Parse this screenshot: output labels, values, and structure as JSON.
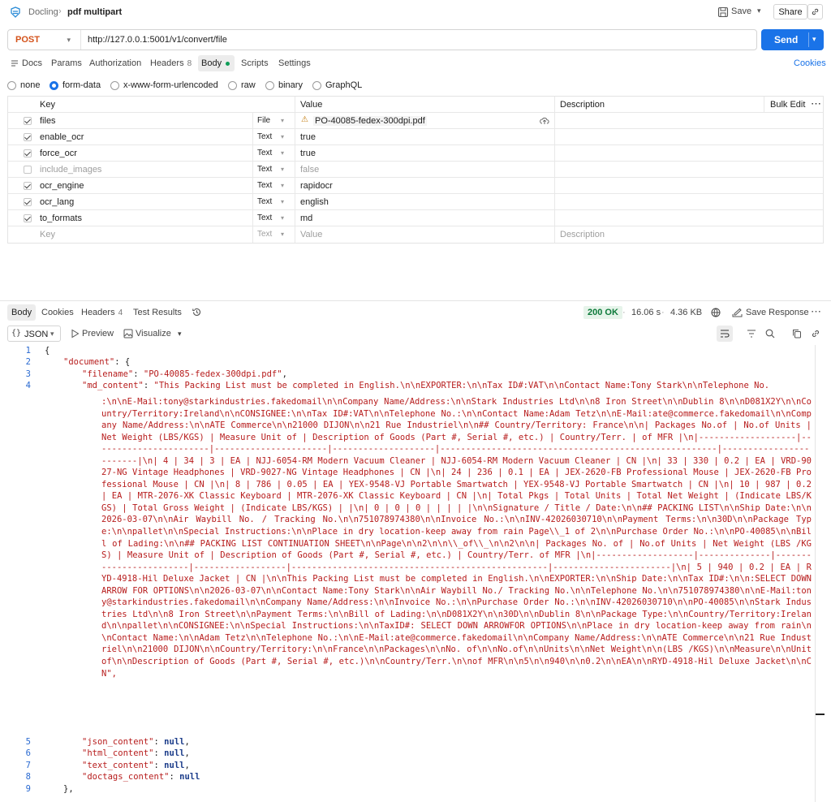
{
  "header": {
    "breadcrumb_root": "Docling",
    "breadcrumb_sep": "›",
    "request_name": "pdf multipart",
    "save_label": "Save",
    "share_label": "Share"
  },
  "request": {
    "method": "POST",
    "url": "http://127.0.0.1:5001/v1/convert/file",
    "send_label": "Send"
  },
  "tabs": {
    "docs": "Docs",
    "params": "Params",
    "authorization": "Authorization",
    "headers": "Headers",
    "headers_count": "8",
    "body": "Body",
    "scripts": "Scripts",
    "settings": "Settings",
    "cookies": "Cookies"
  },
  "body_types": [
    "none",
    "form-data",
    "x-www-form-urlencoded",
    "raw",
    "binary",
    "GraphQL"
  ],
  "selected_body_type": "form-data",
  "params_table": {
    "headers": {
      "key": "Key",
      "value": "Value",
      "description": "Description",
      "bulk_edit": "Bulk Edit"
    },
    "rows": [
      {
        "checked": true,
        "key": "files",
        "type": "File",
        "value": "PO-40085-fedex-300dpi.pdf"
      },
      {
        "checked": true,
        "key": "enable_ocr",
        "type": "Text",
        "value": "true"
      },
      {
        "checked": true,
        "key": "force_ocr",
        "type": "Text",
        "value": "true"
      },
      {
        "checked": false,
        "key": "include_images",
        "type": "Text",
        "value": "false"
      },
      {
        "checked": true,
        "key": "ocr_engine",
        "type": "Text",
        "value": "rapidocr"
      },
      {
        "checked": true,
        "key": "ocr_lang",
        "type": "Text",
        "value": "english"
      },
      {
        "checked": true,
        "key": "to_formats",
        "type": "Text",
        "value": "md"
      }
    ],
    "placeholder_row": {
      "key": "Key",
      "type": "Text",
      "value": "Value",
      "description": "Description"
    }
  },
  "response": {
    "tabs": {
      "body": "Body",
      "cookies": "Cookies",
      "headers": "Headers",
      "headers_count": "4",
      "test_results": "Test Results"
    },
    "status": "200 OK",
    "time": "16.06 s",
    "size": "4.36 KB",
    "save_response": "Save Response",
    "format": "JSON",
    "preview": "Preview",
    "visualize": "Visualize"
  },
  "code": {
    "line1": "{",
    "line2_key": "\"document\"",
    "line2_rest": ": {",
    "line3_key": "\"filename\"",
    "line3_val": "\"PO-40085-fedex-300dpi.pdf\"",
    "line4_key": "\"md_content\"",
    "line4_first": "\"This Packing List must be completed in English.\\n\\nEXPORTER:\\n\\nTax ID#:VAT\\n\\nContact Name:Tony Stark\\n\\nTelephone No.",
    "md_content_rest": ":\\n\\nE-Mail:tony@starkindustries.fakedomail\\n\\nCompany Name/Address:\\n\\nStark Industries Ltd\\n\\n8 Iron Street\\n\\nDublin 8\\n\\nD081X2Y\\n\\nCountry/Territory:Ireland\\n\\nCONSIGNEE:\\n\\nTax ID#:VAT\\n\\nTelephone No.:\\n\\nContact Name:Adam Tetz\\n\\nE-Mail:ate@commerce.fakedomail\\n\\nCompany Name/Address:\\n\\nATE Commerce\\n\\n21000 DIJON\\n\\n21 Rue Industriel\\n\\n## Country/Territory: France\\n\\n| Packages No.of | No.of Units | Net Weight (LBS/KGS) | Measure Unit of | Description of Goods (Part #, Serial #, etc.) | Country/Terr. | of MFR |\\n|-------------------|-----------------------|----------------------|--------------------|------------------------------------------------------|------------------------|\\n| 4 | 34 | 3 | EA | NJJ-6054-RM Modern Vacuum Cleaner | NJJ-6054-RM Modern Vacuum Cleaner | CN |\\n| 33 | 330 | 0.2 | EA | VRD-9027-NG Vintage Headphones | VRD-9027-NG Vintage Headphones | CN |\\n| 24 | 236 | 0.1 | EA | JEX-2620-FB Professional Mouse | JEX-2620-FB Professional Mouse | CN |\\n| 8 | 786 | 0.05 | EA | YEX-9548-VJ Portable Smartwatch | YEX-9548-VJ Portable Smartwatch | CN |\\n| 10 | 987 | 0.2 | EA | MTR-2076-XK Classic Keyboard | MTR-2076-XK Classic Keyboard | CN |\\n| Total Pkgs | Total Units | Total Net Weight | (Indicate LBS/KGS) | Total Gross Weight | (Indicate LBS/KGS) | |\\n| 0 | 0 | 0 | | | | |\\n\\nSignature / Title / Date:\\n\\n## PACKING LIST\\n\\nShip Date:\\n\\n2026-03-07\\n\\nAir Waybill No. / Tracking No.\\n\\n751078974380\\n\\nInvoice No.:\\n\\nINV-42026030710\\n\\nPayment Terms:\\n\\n30D\\n\\nPackage Type:\\n\\npallet\\n\\nSpecial Instructions:\\n\\nPlace in dry location-keep away from rain Page\\\\_1 of 2\\n\\nPurchase Order No.:\\n\\nPO-40085\\n\\nBill of Lading:\\n\\n## PACKING LIST CONTINUATION SHEET\\n\\nPage\\n\\n2\\n\\n\\\\_of\\\\_\\n\\n2\\n\\n| Packages No. of | No.of Units | Net Weight (LBS /KGS) | Measure Unit of | Description of Goods (Part #, Serial #, etc.) | Country/Terr. of MFR |\\n|-------------------|--------------|------------------------|------------------|--------------------------------------------------|-----------------------|\\n| 5 | 940 | 0.2 | EA | RYD-4918-Hil Deluxe Jacket | CN |\\n\\nThis Packing List must be completed in English.\\n\\nEXPORTER:\\n\\nShip Date:\\n\\nTax ID#:\\n\\n:SELECT DOWN ARROW FOR OPTIONS\\n\\n2026-03-07\\n\\nContact Name:Tony Stark\\n\\nAir Waybill No./ Tracking No.\\n\\nTelephone No.\\n\\n751078974380\\n\\nE-Mail:tony@starkindustries.fakedomail\\n\\nCompany Name/Address:\\n\\nInvoice No.:\\n\\nPurchase Order No.:\\n\\nINV-42026030710\\n\\nPO-40085\\n\\nStark Industries Ltd\\n\\n8 Iron Street\\n\\nPayment Terms:\\n\\nBill of Lading:\\n\\nD081X2Y\\n\\n30D\\n\\nDublin 8\\n\\nPackage Type:\\n\\nCountry/Territory:Ireland\\n\\npallet\\n\\nCONSIGNEE:\\n\\nSpecial Instructions:\\n\\nTaxID#: SELECT DOWN ARROWFOR OPTIONS\\n\\nPlace in dry location-keep away from rain\\n\\nContact Name:\\n\\nAdam Tetz\\n\\nTelephone No.:\\n\\nE-Mail:ate@commerce.fakedomail\\n\\nCompany Name/Address:\\n\\nATE Commerce\\n\\n21 Rue Industriel\\n\\n21000 DIJON\\n\\nCountry/Territory:\\n\\nFrance\\n\\nPackages\\n\\nNo. of\\n\\nNo.of\\n\\nUnits\\n\\nNet Weight\\n\\n(LBS /KGS)\\n\\nMeasure\\n\\nUnit of\\n\\nDescription of Goods (Part #, Serial #, etc.)\\n\\nCountry/Terr.\\n\\nof MFR\\n\\n5\\n\\n940\\n\\n0.2\\n\\nEA\\n\\nRYD-4918-Hil Deluxe Jacket\\n\\nCN\",",
    "line5_key": "\"json_content\"",
    "line6_key": "\"html_content\"",
    "line7_key": "\"text_content\"",
    "line8_key": "\"doctags_content\"",
    "null_val": "null",
    "line9": "},",
    "line_numbers": [
      "1",
      "2",
      "3",
      "4",
      "5",
      "6",
      "7",
      "8",
      "9"
    ]
  }
}
